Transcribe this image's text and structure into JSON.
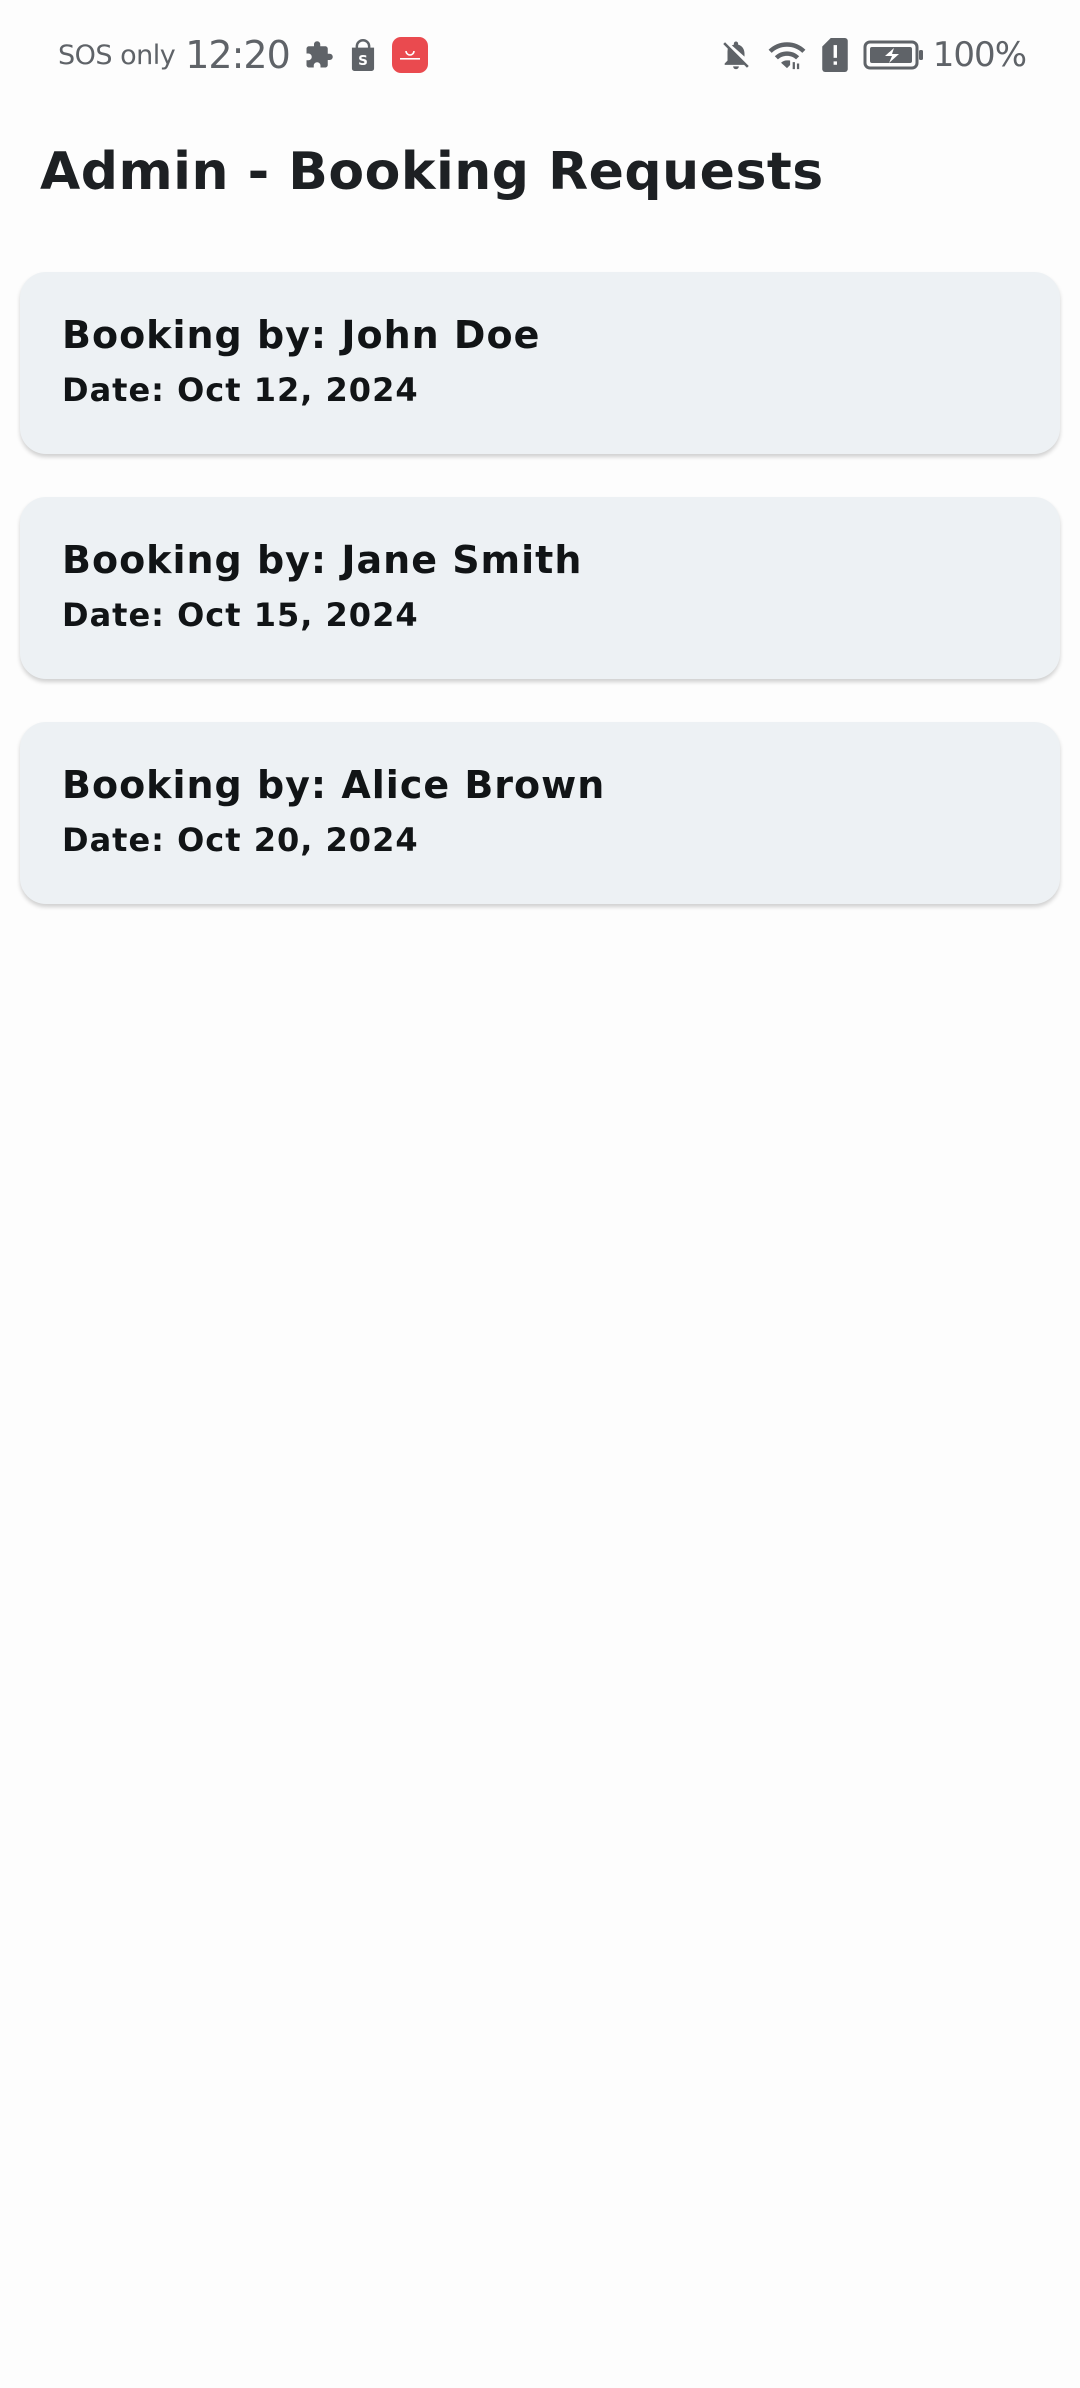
{
  "status_bar": {
    "carrier": "SOS only",
    "time": "12:20",
    "battery_percent": "100%",
    "left_icons": [
      "puzzle-icon",
      "shopping-bag-icon",
      "huawei-appgallery-icon"
    ],
    "right_icons": [
      "bell-off-icon",
      "wifi-icon",
      "sim-alert-icon",
      "battery-charging-icon"
    ]
  },
  "header": {
    "title": "Admin - Booking Requests"
  },
  "bookings": [
    {
      "by": "Booking by: John Doe",
      "date": "Date: Oct 12, 2024"
    },
    {
      "by": "Booking by: Jane Smith",
      "date": "Date: Oct 15, 2024"
    },
    {
      "by": "Booking by: Alice Brown",
      "date": "Date: Oct 20, 2024"
    }
  ],
  "colors": {
    "background": "#fdfdfd",
    "card_background": "#edf1f4",
    "text_primary": "#111416",
    "status_text": "#5f6368",
    "huawei_red": "#ea4a4f"
  }
}
